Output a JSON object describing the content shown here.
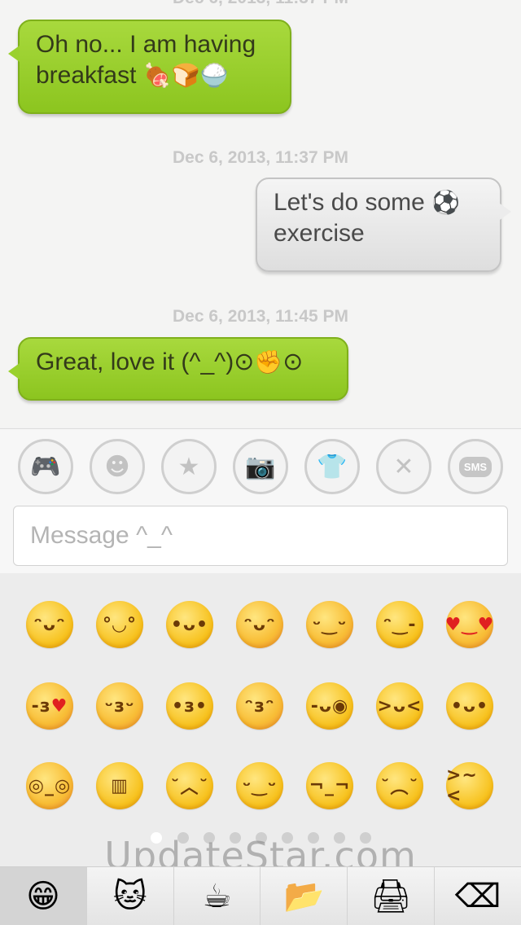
{
  "chat": {
    "messages": [
      {
        "side": "left",
        "text": "Oh no... I am having",
        "text2": "breakfast",
        "emojis": "🍖🍞🍚"
      },
      {
        "timestamp": "Dec 6, 2013, 11:37 PM"
      },
      {
        "side": "right",
        "text": "Let's do some",
        "emojis": "⚽",
        "text2": "exercise"
      },
      {
        "timestamp": "Dec 6, 2013, 11:45 PM"
      },
      {
        "side": "left",
        "text": "Great, love it (^_^)⊙",
        "emojis": "✊",
        "text3": "⊙"
      }
    ]
  },
  "toolbar": {
    "icons": [
      "gamepad-icon",
      "face-icon",
      "star-icon",
      "camera-icon",
      "shirt-icon",
      "close-icon",
      "sms-icon"
    ],
    "sms_label": "SMS",
    "message_placeholder": "Message ^_^"
  },
  "emoji_panel": {
    "rows": 3,
    "columns": 7,
    "page_count": 9,
    "active_page": 1
  },
  "watermark": "UpdateStar.com",
  "tabs": [
    {
      "icon": "grin-emoji-icon",
      "glyph": "😁",
      "active": true
    },
    {
      "icon": "hello-kitty-icon",
      "glyph": "🐱",
      "active": false
    },
    {
      "icon": "coffee-cup-icon",
      "glyph": "☕",
      "active": false
    },
    {
      "icon": "folder-icon",
      "glyph": "📂",
      "active": false
    },
    {
      "icon": "printer-icon",
      "glyph": "🖨",
      "active": false
    },
    {
      "icon": "backspace-icon",
      "glyph": "⌫",
      "active": false
    }
  ]
}
